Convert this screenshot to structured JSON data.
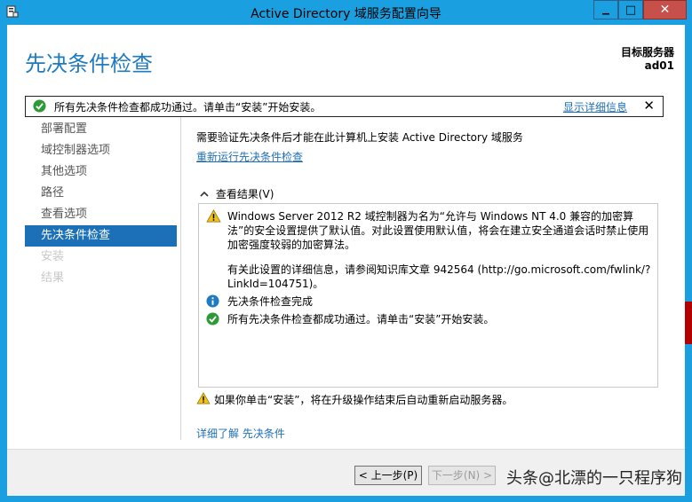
{
  "window": {
    "title": "Active Directory 域服务配置向导",
    "accent": "#1a9fe0",
    "close_label": "✕",
    "maximize_label": "□",
    "minimize_label": "▁"
  },
  "header": {
    "page_title": "先决条件检查",
    "target_server_label": "目标服务器",
    "target_server_name": "ad01"
  },
  "banner": {
    "icon": "success-check-icon",
    "text": "所有先决条件检查都成功通过。请单击“安装”开始安装。",
    "details_link": "显示详细信息",
    "close": "✕"
  },
  "sidebar": {
    "items": [
      {
        "label": "部署配置",
        "state": "normal"
      },
      {
        "label": "域控制器选项",
        "state": "normal"
      },
      {
        "label": "其他选项",
        "state": "normal"
      },
      {
        "label": "路径",
        "state": "normal"
      },
      {
        "label": "查看选项",
        "state": "normal"
      },
      {
        "label": "先决条件检查",
        "state": "selected"
      },
      {
        "label": "安装",
        "state": "disabled"
      },
      {
        "label": "结果",
        "state": "disabled"
      }
    ]
  },
  "main": {
    "intro": "需要验证先决条件后才能在此计算机上安装 Active Directory 域服务",
    "rerun_link": "重新运行先决条件检查",
    "results_toggle": "查看结果(V)",
    "results": [
      {
        "icon": "warning-icon",
        "text": "Windows Server 2012 R2 域控制器为名为“允许与 Windows NT 4.0 兼容的加密算法”的安全设置提供了默认值。对此设置使用默认值，将会在建立安全通道会话时禁止使用加密强度较弱的加密算法。"
      },
      {
        "icon": "none",
        "text": "有关此设置的详细信息，请参阅知识库文章 942564 (http://go.microsoft.com/fwlink/?LinkId=104751)。"
      },
      {
        "icon": "info-icon",
        "text": "先决条件检查完成"
      },
      {
        "icon": "success-check-icon",
        "text": "所有先决条件检查都成功通过。请单击“安装”开始安装。"
      }
    ],
    "restart_note": "如果你单击“安装”，将在升级操作结束后自动重新启动服务器。",
    "learn_more": "详细了解 先决条件"
  },
  "footer": {
    "prev_button": "< 上一步(P)",
    "next_button": "下一步(N) >",
    "watermark": "头条@北漂的一只程序狗"
  }
}
